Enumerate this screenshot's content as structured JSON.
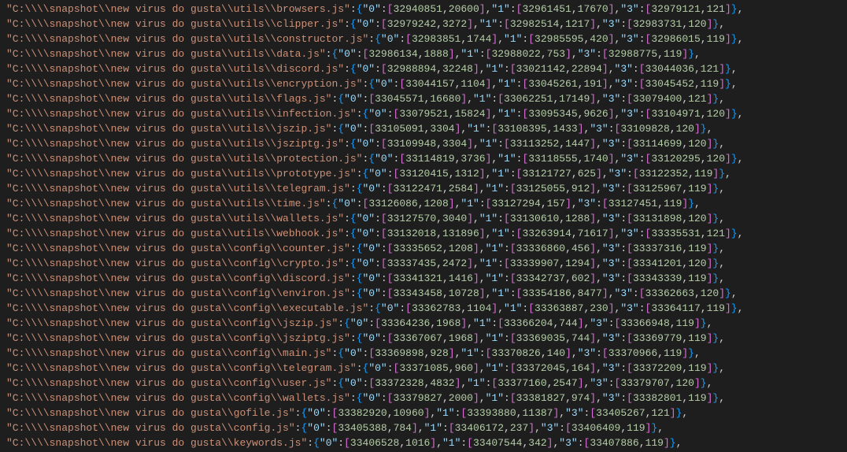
{
  "lines": [
    {
      "path": "\"C:\\\\\\\\snapshot\\\\new virus do gusta\\\\utils\\\\browsers.js\"",
      "v": {
        "0": [
          32940851,
          20600
        ],
        "1": [
          32961451,
          17670
        ],
        "3": [
          32979121,
          121
        ]
      }
    },
    {
      "path": "\"C:\\\\\\\\snapshot\\\\new virus do gusta\\\\utils\\\\clipper.js\"",
      "v": {
        "0": [
          32979242,
          3272
        ],
        "1": [
          32982514,
          1217
        ],
        "3": [
          32983731,
          120
        ]
      }
    },
    {
      "path": "\"C:\\\\\\\\snapshot\\\\new virus do gusta\\\\utils\\\\constructor.js\"",
      "v": {
        "0": [
          32983851,
          1744
        ],
        "1": [
          32985595,
          420
        ],
        "3": [
          32986015,
          119
        ]
      }
    },
    {
      "path": "\"C:\\\\\\\\snapshot\\\\new virus do gusta\\\\utils\\\\data.js\"",
      "v": {
        "0": [
          32986134,
          1888
        ],
        "1": [
          32988022,
          753
        ],
        "3": [
          32988775,
          119
        ]
      }
    },
    {
      "path": "\"C:\\\\\\\\snapshot\\\\new virus do gusta\\\\utils\\\\discord.js\"",
      "v": {
        "0": [
          32988894,
          32248
        ],
        "1": [
          33021142,
          22894
        ],
        "3": [
          33044036,
          121
        ]
      }
    },
    {
      "path": "\"C:\\\\\\\\snapshot\\\\new virus do gusta\\\\utils\\\\encryption.js\"",
      "v": {
        "0": [
          33044157,
          1104
        ],
        "1": [
          33045261,
          191
        ],
        "3": [
          33045452,
          119
        ]
      }
    },
    {
      "path": "\"C:\\\\\\\\snapshot\\\\new virus do gusta\\\\utils\\\\flags.js\"",
      "v": {
        "0": [
          33045571,
          16680
        ],
        "1": [
          33062251,
          17149
        ],
        "3": [
          33079400,
          121
        ]
      }
    },
    {
      "path": "\"C:\\\\\\\\snapshot\\\\new virus do gusta\\\\utils\\\\infection.js\"",
      "v": {
        "0": [
          33079521,
          15824
        ],
        "1": [
          33095345,
          9626
        ],
        "3": [
          33104971,
          120
        ]
      }
    },
    {
      "path": "\"C:\\\\\\\\snapshot\\\\new virus do gusta\\\\utils\\\\jszip.js\"",
      "v": {
        "0": [
          33105091,
          3304
        ],
        "1": [
          33108395,
          1433
        ],
        "3": [
          33109828,
          120
        ]
      }
    },
    {
      "path": "\"C:\\\\\\\\snapshot\\\\new virus do gusta\\\\utils\\\\jsziptg.js\"",
      "v": {
        "0": [
          33109948,
          3304
        ],
        "1": [
          33113252,
          1447
        ],
        "3": [
          33114699,
          120
        ]
      }
    },
    {
      "path": "\"C:\\\\\\\\snapshot\\\\new virus do gusta\\\\utils\\\\protection.js\"",
      "v": {
        "0": [
          33114819,
          3736
        ],
        "1": [
          33118555,
          1740
        ],
        "3": [
          33120295,
          120
        ]
      }
    },
    {
      "path": "\"C:\\\\\\\\snapshot\\\\new virus do gusta\\\\utils\\\\prototype.js\"",
      "v": {
        "0": [
          33120415,
          1312
        ],
        "1": [
          33121727,
          625
        ],
        "3": [
          33122352,
          119
        ]
      }
    },
    {
      "path": "\"C:\\\\\\\\snapshot\\\\new virus do gusta\\\\utils\\\\telegram.js\"",
      "v": {
        "0": [
          33122471,
          2584
        ],
        "1": [
          33125055,
          912
        ],
        "3": [
          33125967,
          119
        ]
      }
    },
    {
      "path": "\"C:\\\\\\\\snapshot\\\\new virus do gusta\\\\utils\\\\time.js\"",
      "v": {
        "0": [
          33126086,
          1208
        ],
        "1": [
          33127294,
          157
        ],
        "3": [
          33127451,
          119
        ]
      }
    },
    {
      "path": "\"C:\\\\\\\\snapshot\\\\new virus do gusta\\\\utils\\\\wallets.js\"",
      "v": {
        "0": [
          33127570,
          3040
        ],
        "1": [
          33130610,
          1288
        ],
        "3": [
          33131898,
          120
        ]
      }
    },
    {
      "path": "\"C:\\\\\\\\snapshot\\\\new virus do gusta\\\\utils\\\\webhook.js\"",
      "v": {
        "0": [
          33132018,
          131896
        ],
        "1": [
          33263914,
          71617
        ],
        "3": [
          33335531,
          121
        ]
      }
    },
    {
      "path": "\"C:\\\\\\\\snapshot\\\\new virus do gusta\\\\config\\\\counter.js\"",
      "v": {
        "0": [
          33335652,
          1208
        ],
        "1": [
          33336860,
          456
        ],
        "3": [
          33337316,
          119
        ]
      }
    },
    {
      "path": "\"C:\\\\\\\\snapshot\\\\new virus do gusta\\\\config\\\\crypto.js\"",
      "v": {
        "0": [
          33337435,
          2472
        ],
        "1": [
          33339907,
          1294
        ],
        "3": [
          33341201,
          120
        ]
      }
    },
    {
      "path": "\"C:\\\\\\\\snapshot\\\\new virus do gusta\\\\config\\\\discord.js\"",
      "v": {
        "0": [
          33341321,
          1416
        ],
        "1": [
          33342737,
          602
        ],
        "3": [
          33343339,
          119
        ]
      }
    },
    {
      "path": "\"C:\\\\\\\\snapshot\\\\new virus do gusta\\\\config\\\\environ.js\"",
      "v": {
        "0": [
          33343458,
          10728
        ],
        "1": [
          33354186,
          8477
        ],
        "3": [
          33362663,
          120
        ]
      }
    },
    {
      "path": "\"C:\\\\\\\\snapshot\\\\new virus do gusta\\\\config\\\\executable.js\"",
      "v": {
        "0": [
          33362783,
          1104
        ],
        "1": [
          33363887,
          230
        ],
        "3": [
          33364117,
          119
        ]
      }
    },
    {
      "path": "\"C:\\\\\\\\snapshot\\\\new virus do gusta\\\\config\\\\jszip.js\"",
      "v": {
        "0": [
          33364236,
          1968
        ],
        "1": [
          33366204,
          744
        ],
        "3": [
          33366948,
          119
        ]
      }
    },
    {
      "path": "\"C:\\\\\\\\snapshot\\\\new virus do gusta\\\\config\\\\jsziptg.js\"",
      "v": {
        "0": [
          33367067,
          1968
        ],
        "1": [
          33369035,
          744
        ],
        "3": [
          33369779,
          119
        ]
      }
    },
    {
      "path": "\"C:\\\\\\\\snapshot\\\\new virus do gusta\\\\config\\\\main.js\"",
      "v": {
        "0": [
          33369898,
          928
        ],
        "1": [
          33370826,
          140
        ],
        "3": [
          33370966,
          119
        ]
      }
    },
    {
      "path": "\"C:\\\\\\\\snapshot\\\\new virus do gusta\\\\config\\\\telegram.js\"",
      "v": {
        "0": [
          33371085,
          960
        ],
        "1": [
          33372045,
          164
        ],
        "3": [
          33372209,
          119
        ]
      }
    },
    {
      "path": "\"C:\\\\\\\\snapshot\\\\new virus do gusta\\\\config\\\\user.js\"",
      "v": {
        "0": [
          33372328,
          4832
        ],
        "1": [
          33377160,
          2547
        ],
        "3": [
          33379707,
          120
        ]
      }
    },
    {
      "path": "\"C:\\\\\\\\snapshot\\\\new virus do gusta\\\\config\\\\wallets.js\"",
      "v": {
        "0": [
          33379827,
          2000
        ],
        "1": [
          33381827,
          974
        ],
        "3": [
          33382801,
          119
        ]
      }
    },
    {
      "path": "\"C:\\\\\\\\snapshot\\\\new virus do gusta\\\\gofile.js\"",
      "v": {
        "0": [
          33382920,
          10960
        ],
        "1": [
          33393880,
          11387
        ],
        "3": [
          33405267,
          121
        ]
      }
    },
    {
      "path": "\"C:\\\\\\\\snapshot\\\\new virus do gusta\\\\config.js\"",
      "v": {
        "0": [
          33405388,
          784
        ],
        "1": [
          33406172,
          237
        ],
        "3": [
          33406409,
          119
        ]
      }
    },
    {
      "path": "\"C:\\\\\\\\snapshot\\\\new virus do gusta\\\\keywords.js\"",
      "v": {
        "0": [
          33406528,
          1016
        ],
        "1": [
          33407544,
          342
        ],
        "3": [
          33407886,
          119
        ]
      }
    }
  ]
}
